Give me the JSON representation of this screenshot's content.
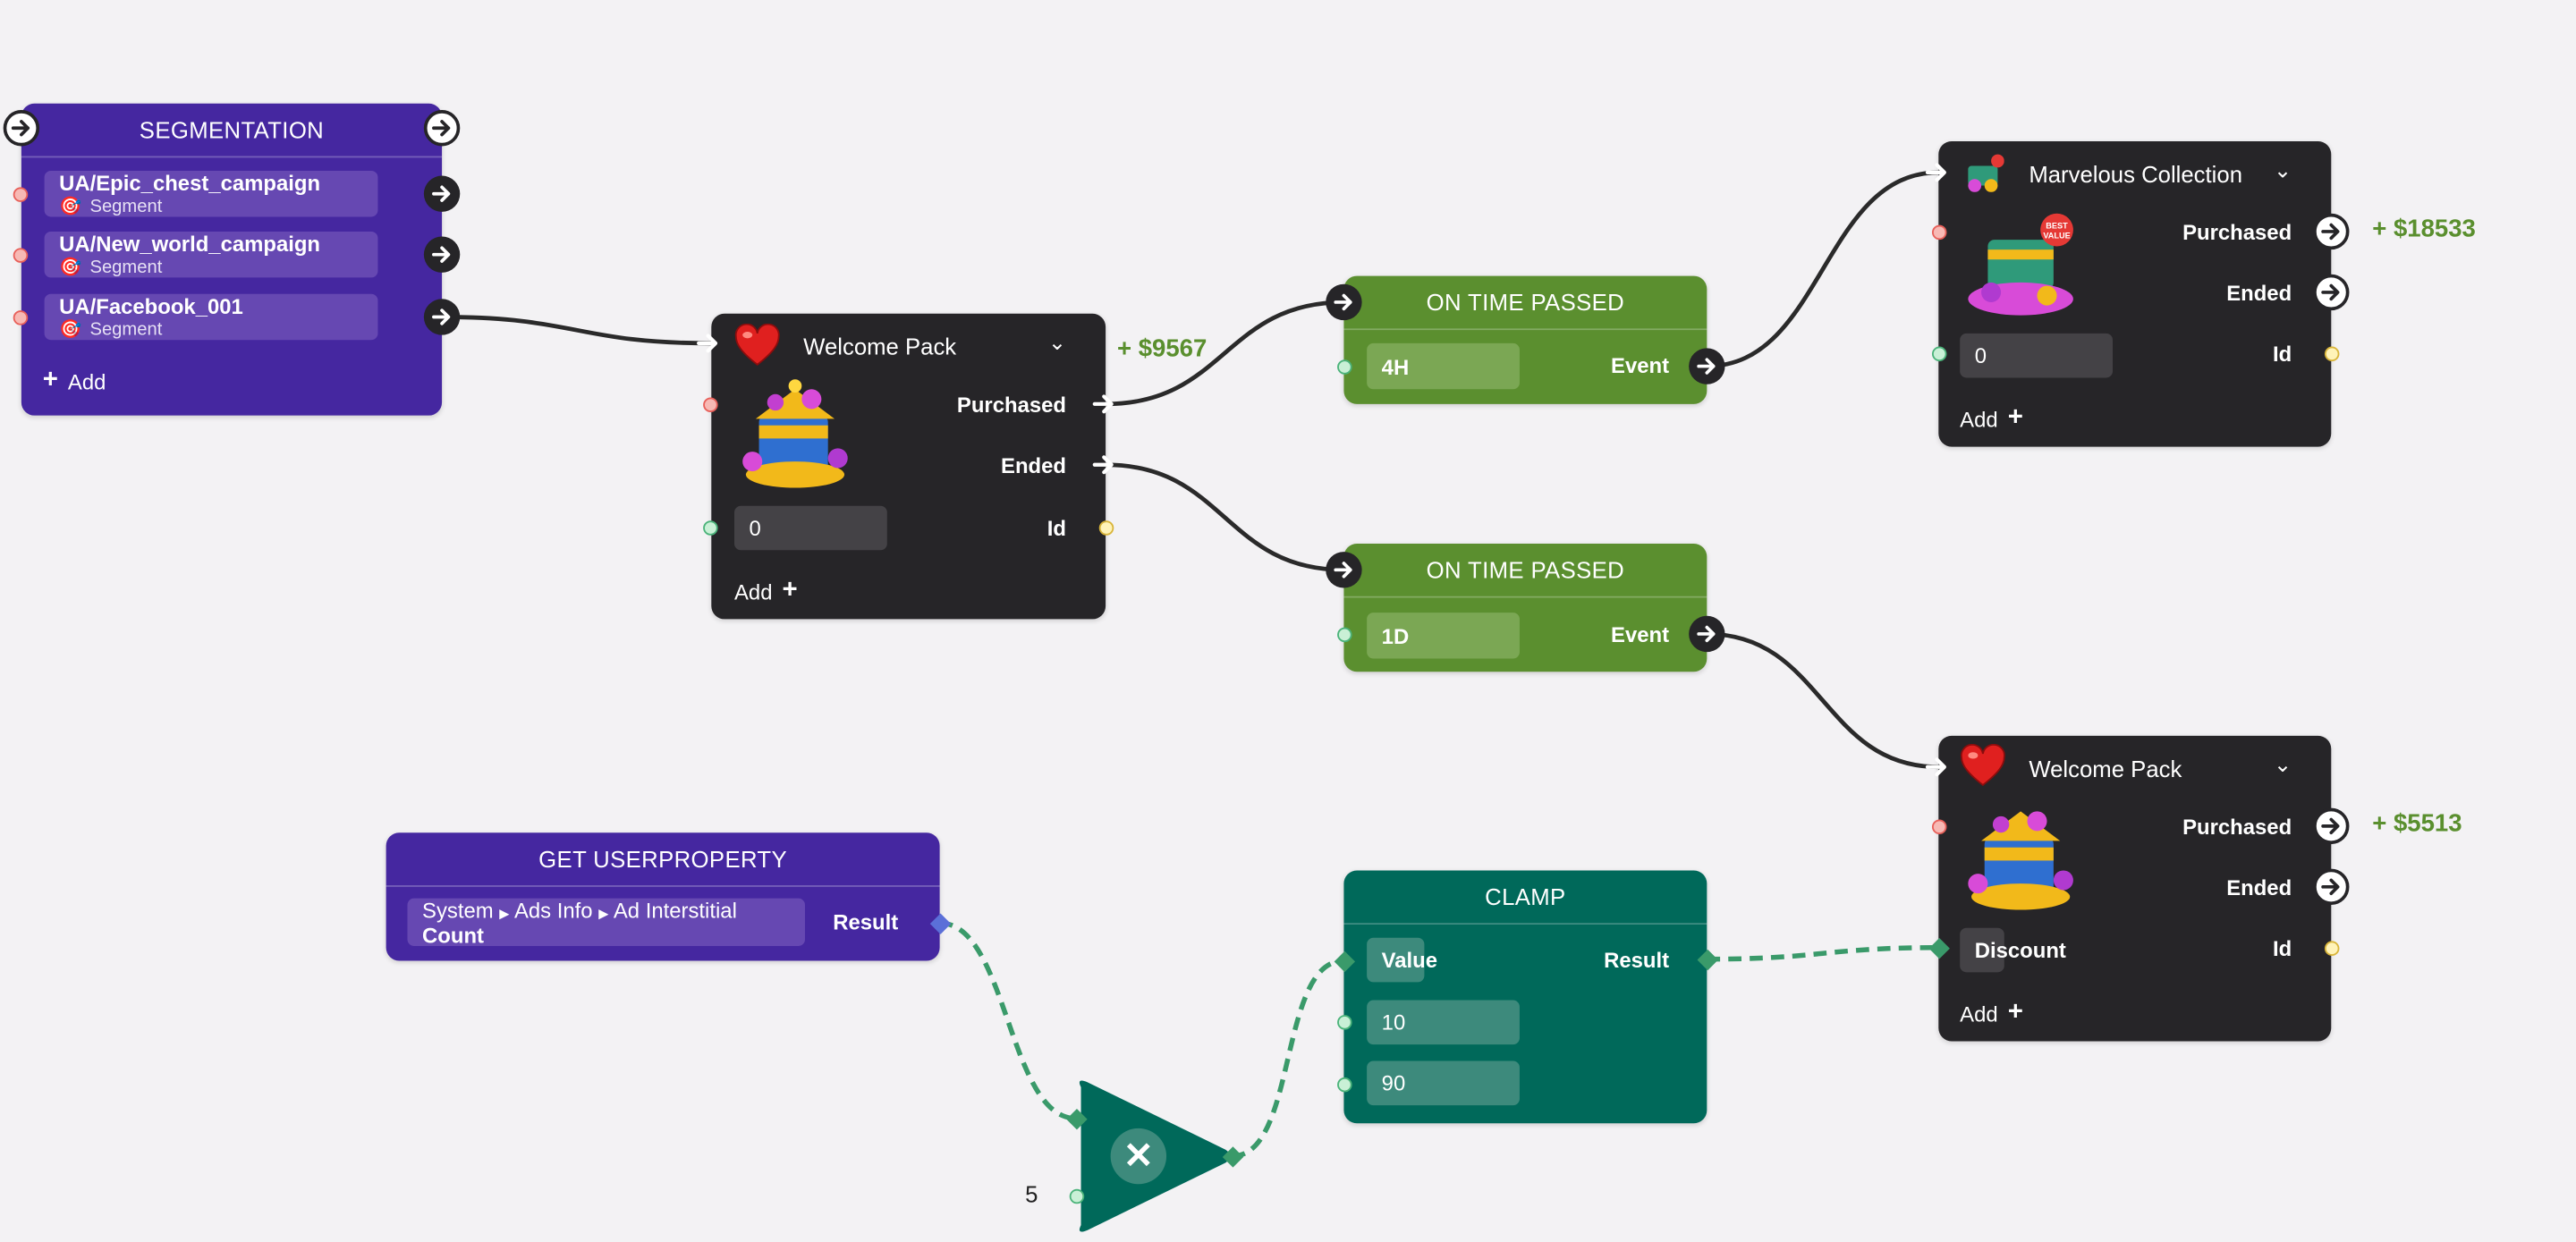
{
  "colors": {
    "canvas": "#f3f2f4",
    "segmentation": "#4527a0",
    "offer_node": "#262528",
    "timer_node": "#5b8f2f",
    "math_node": "#00695a",
    "revenue": "#5a8f2e",
    "data_wire": "#3a9a6a"
  },
  "segmentation": {
    "title": "SEGMENTATION",
    "items": [
      {
        "name": "UA/Epic_chest_campaign",
        "type": "Segment",
        "icon": "target-dart-icon"
      },
      {
        "name": "UA/New_world_campaign",
        "type": "Segment",
        "icon": "target-dart-icon"
      },
      {
        "name": "UA/Facebook_001",
        "type": "Segment",
        "icon": "target-dart-icon"
      }
    ],
    "add_label": "Add"
  },
  "welcome_pack_1": {
    "title": "Welcome Pack",
    "icon": "heart-icon",
    "purchased": "Purchased",
    "ended": "Ended",
    "id_label": "Id",
    "id_value": "0",
    "add_label": "Add",
    "revenue": "+ $9567"
  },
  "timer_1": {
    "title": "ON TIME PASSED",
    "value": "4H",
    "event": "Event"
  },
  "timer_2": {
    "title": "ON TIME PASSED",
    "value": "1D",
    "event": "Event"
  },
  "marvelous": {
    "title": "Marvelous Collection",
    "icon": "gem-chest-icon",
    "badge": "BEST VALUE",
    "purchased": "Purchased",
    "ended": "Ended",
    "id_label": "Id",
    "id_value": "0",
    "add_label": "Add",
    "revenue": "+ $18533"
  },
  "welcome_pack_2": {
    "title": "Welcome Pack",
    "icon": "heart-icon",
    "purchased": "Purchased",
    "ended": "Ended",
    "id_label": "Id",
    "id_value": "Discount",
    "add_label": "Add",
    "revenue": "+ $5513"
  },
  "get_userproperty": {
    "title": "GET USERPROPERTY",
    "path": [
      "System",
      "Ads Info",
      "Ad Interstitial"
    ],
    "property": "Count",
    "result": "Result"
  },
  "clamp": {
    "title": "CLAMP",
    "value_label": "Value",
    "result": "Result",
    "min": "10",
    "max": "90"
  },
  "multiply": {
    "operator": "multiply-icon",
    "operand": "5"
  }
}
